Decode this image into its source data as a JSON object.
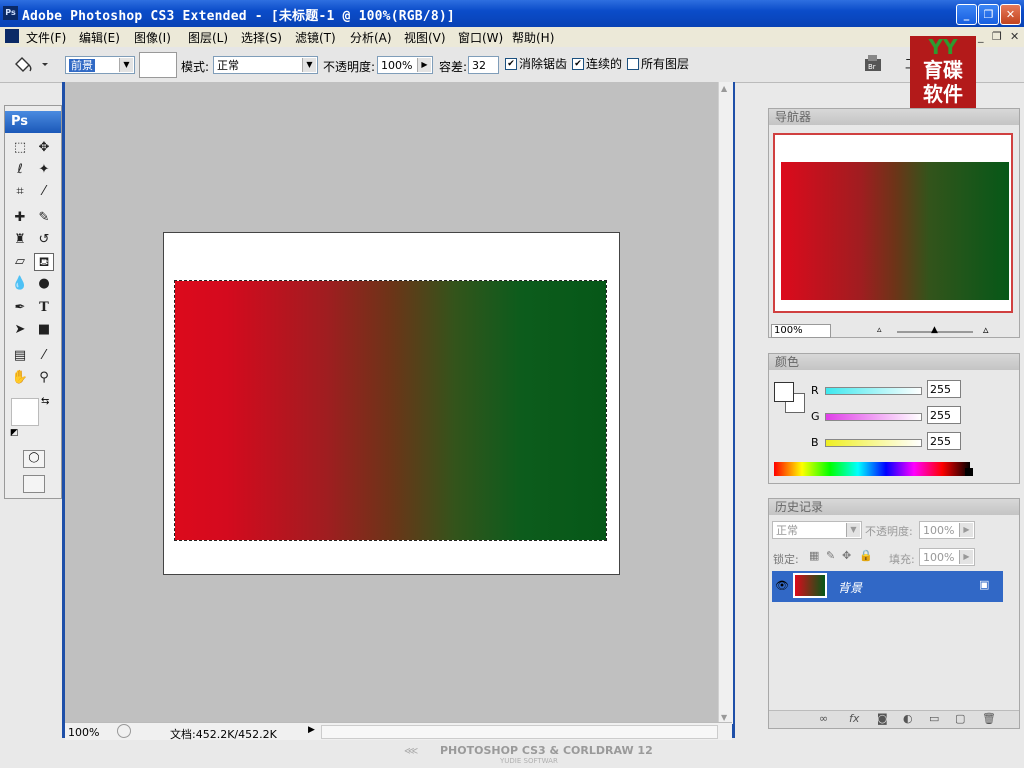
{
  "window": {
    "title": "Adobe Photoshop CS3 Extended - [未标题-1 @ 100%(RGB/8)]",
    "app_icon": "Ps",
    "controls": {
      "minimize": "_",
      "restore": "❐",
      "close": "✕"
    }
  },
  "menu": {
    "items": [
      "文件(F)",
      "编辑(E)",
      "图像(I)",
      "图层(L)",
      "选择(S)",
      "滤镜(T)",
      "分析(A)",
      "视图(V)",
      "窗口(W)",
      "帮助(H)"
    ],
    "doc_controls": {
      "minimize": "_",
      "restore": "❐",
      "close": "✕"
    }
  },
  "options_bar": {
    "fill_source": "前景",
    "pattern": "",
    "mode_label": "模式:",
    "mode_value": "正常",
    "opacity_label": "不透明度:",
    "opacity_value": "100%",
    "tolerance_label": "容差:",
    "tolerance_value": "32",
    "anti_alias_label": "消除锯齿",
    "anti_alias_checked": true,
    "contiguous_label": "连续的",
    "contiguous_checked": true,
    "all_layers_label": "所有图层",
    "all_layers_checked": false,
    "workspace_label": "工"
  },
  "watermark_logo": {
    "top": "YY",
    "line1": "育碟",
    "line2": "软件"
  },
  "toolbox": {
    "header": "Ps",
    "active_tool": "paint-bucket"
  },
  "canvas": {
    "gradient_colors": [
      "#dc0a1c",
      "#6d3418",
      "#065818"
    ]
  },
  "status": {
    "zoom": "100%",
    "doc_info": "文档:452.2K/452.2K"
  },
  "navigator": {
    "title": "导航器",
    "zoom": "100%"
  },
  "color_panel": {
    "title": "颜色",
    "channels": [
      {
        "label": "R",
        "value": "255"
      },
      {
        "label": "G",
        "value": "255"
      },
      {
        "label": "B",
        "value": "255"
      }
    ]
  },
  "layers_panel": {
    "title": "历史记录",
    "blend_mode": "正常",
    "opacity_label": "不透明度:",
    "opacity_value": "100%",
    "lock_label": "锁定:",
    "fill_label": "填充:",
    "fill_value": "100%",
    "layer": {
      "name": "背景",
      "visible": true,
      "locked": true
    }
  },
  "footer": {
    "title": "PHOTOSHOP CS3 & CORLDRAW 12",
    "subtitle": "YUDIE SOFTWAR"
  }
}
